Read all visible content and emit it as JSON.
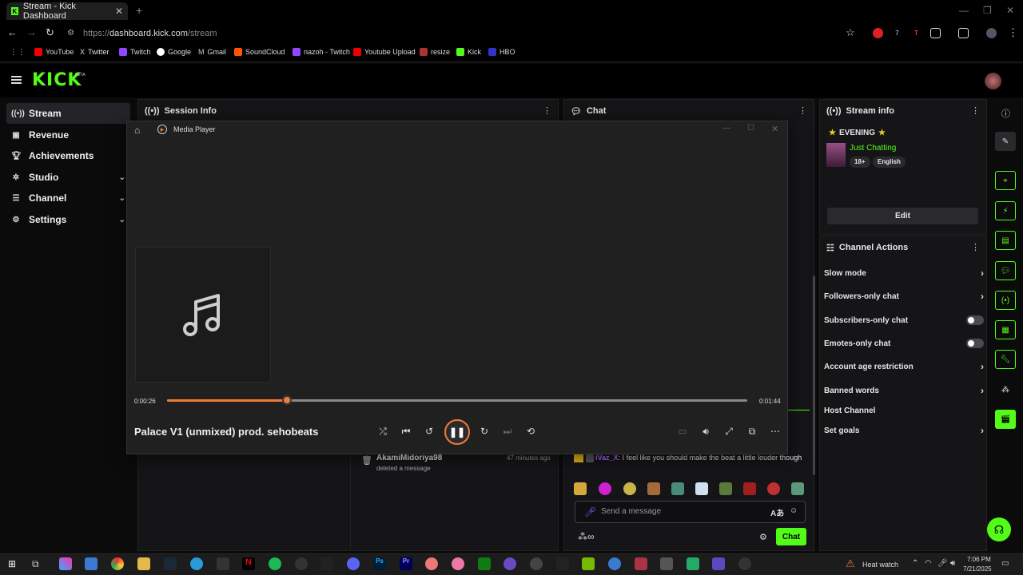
{
  "browser": {
    "tab_title": "Stream - Kick Dashboard",
    "url_prefix": "https://",
    "url_host": "dashboard.kick.com",
    "url_path": "/stream",
    "bookmarks": [
      "YouTube",
      "Twitter",
      "Twitch",
      "Google",
      "Gmail",
      "SoundCloud",
      "nazoh - Twitch",
      "Youtube Upload",
      "resize",
      "Kick",
      "HBO"
    ]
  },
  "kick": {
    "brand": "KICK",
    "beta": "BETA"
  },
  "sidebar": {
    "items": [
      {
        "label": "Stream",
        "icon": "broadcast-icon"
      },
      {
        "label": "Revenue",
        "icon": "bank-icon"
      },
      {
        "label": "Achievements",
        "icon": "trophy-icon"
      },
      {
        "label": "Studio",
        "icon": "gear-icon"
      },
      {
        "label": "Channel",
        "icon": "list-icon"
      },
      {
        "label": "Settings",
        "icon": "settings-icon"
      }
    ]
  },
  "panels": {
    "session": "Session Info",
    "chat": "Chat",
    "stream_info": "Stream info",
    "channel_actions": "Channel Actions"
  },
  "stream_info": {
    "title": "EVENING",
    "category": "Just Chatting",
    "tags": [
      "18+",
      "English"
    ],
    "edit": "Edit"
  },
  "channel_actions": [
    {
      "label": "Slow mode",
      "control": "arrow"
    },
    {
      "label": "Followers-only chat",
      "control": "arrow"
    },
    {
      "label": "Subscribers-only chat",
      "control": "toggle"
    },
    {
      "label": "Emotes-only chat",
      "control": "toggle"
    },
    {
      "label": "Account age restriction",
      "control": "arrow"
    },
    {
      "label": "Banned words",
      "control": "arrow"
    },
    {
      "label": "Host Channel",
      "control": "none"
    },
    {
      "label": "Set goals",
      "control": "arrow"
    }
  ],
  "session_log": {
    "user": "AkamiMidoriya98",
    "time": "47 minutes ago",
    "action": "deleted a message"
  },
  "chat": {
    "user": "iVaz_X",
    "message": ": I feel like you should make the beat a little louder though",
    "placeholder": "Send a message",
    "send": "Chat"
  },
  "media_player": {
    "app": "Media Player",
    "elapsed": "0:00:26",
    "duration": "0:01:44",
    "progress": 0.206,
    "track": "Palace V1 (unmixed) prod. sehobeats",
    "skip_back": "10",
    "skip_fwd": "30"
  },
  "taskbar": {
    "weather": "Heat watch",
    "time": "7:06 PM",
    "date": "7/21/2025"
  }
}
